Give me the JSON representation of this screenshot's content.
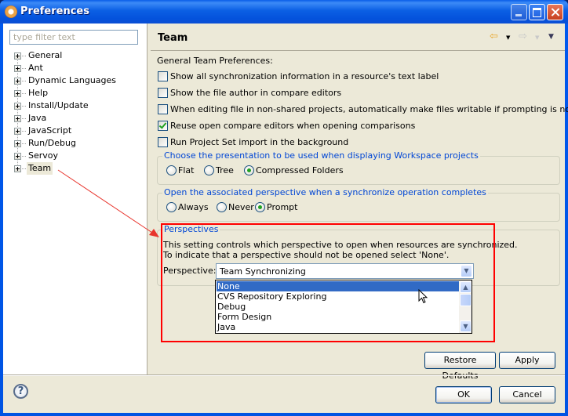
{
  "window": {
    "title": "Preferences",
    "controls": {
      "minimize": "minimize",
      "maximize": "maximize",
      "close": "close"
    }
  },
  "sidebar": {
    "filter_placeholder": "type filter text",
    "items": [
      {
        "label": "General",
        "selected": false
      },
      {
        "label": "Ant",
        "selected": false
      },
      {
        "label": "Dynamic Languages",
        "selected": false
      },
      {
        "label": "Help",
        "selected": false
      },
      {
        "label": "Install/Update",
        "selected": false
      },
      {
        "label": "Java",
        "selected": false
      },
      {
        "label": "JavaScript",
        "selected": false
      },
      {
        "label": "Run/Debug",
        "selected": false
      },
      {
        "label": "Servoy",
        "selected": false
      },
      {
        "label": "Team",
        "selected": true
      }
    ]
  },
  "page": {
    "title": "Team",
    "nav_icons": [
      "back-arrow-icon",
      "forward-arrow-icon",
      "view-menu-icon"
    ],
    "general_label": "General Team Preferences:",
    "checkboxes": [
      {
        "label": "Show all synchronization information in a resource's text label",
        "checked": false
      },
      {
        "label": "Show the file author in compare editors",
        "checked": false
      },
      {
        "label": "When editing file in non-shared projects, automatically make files writable if prompting is not possible",
        "checked": false
      },
      {
        "label": "Reuse open compare editors when opening comparisons",
        "checked": true
      },
      {
        "label": "Run Project Set import in the background",
        "checked": false
      }
    ],
    "presentation_group": {
      "title": "Choose the presentation to be used when displaying Workspace projects",
      "options": [
        {
          "label": "Flat",
          "selected": false
        },
        {
          "label": "Tree",
          "selected": false
        },
        {
          "label": "Compressed Folders",
          "selected": true
        }
      ]
    },
    "perspective_open_group": {
      "title": "Open the associated perspective when a synchronize operation completes",
      "options": [
        {
          "label": "Always",
          "selected": false
        },
        {
          "label": "Never",
          "selected": false
        },
        {
          "label": "Prompt",
          "selected": true
        }
      ]
    },
    "perspectives_group": {
      "title": "Perspectives",
      "desc_line1": "This setting controls which perspective to open when resources are synchronized.",
      "desc_line2": "To indicate that a perspective should not be opened select 'None'.",
      "field_label": "Perspective:",
      "selected_value": "Team Synchronizing",
      "dropdown_options": [
        "None",
        "CVS Repository Exploring",
        "Debug",
        "Form Design",
        "Java"
      ],
      "highlighted_option": "None"
    },
    "restore_defaults_label": "Restore Defaults",
    "apply_label": "Apply"
  },
  "footer": {
    "help_label": "?",
    "ok_label": "OK",
    "cancel_label": "Cancel"
  },
  "annotation": {
    "color": "#ff0000"
  }
}
